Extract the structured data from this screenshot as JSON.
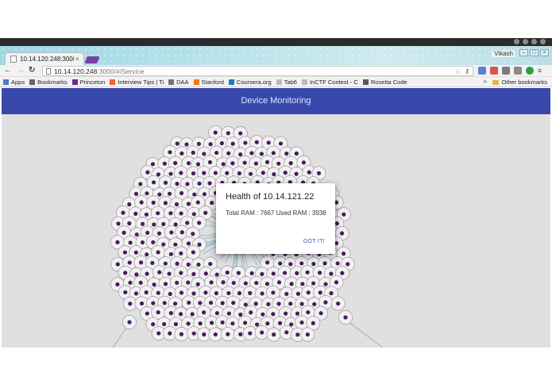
{
  "browser": {
    "tab": {
      "title": "10.14.120.248:3000/",
      "close_glyph": "×"
    },
    "profile_name": "Vikash",
    "address": {
      "host": "10.14.120.248",
      "path": ":3000/#/Service"
    },
    "bookmarks": [
      {
        "label": "Apps",
        "icon": "apps-grid-icon"
      },
      {
        "label": "Bookmarks",
        "icon": "star-icon"
      },
      {
        "label": "Princeton",
        "icon": "princeton-icon"
      },
      {
        "label": "Interview Tips | Ti",
        "icon": "yc-icon"
      },
      {
        "label": "DAA",
        "icon": "image-icon"
      },
      {
        "label": "Stanford",
        "icon": "blogger-icon"
      },
      {
        "label": "Coursera.org",
        "icon": "coursera-icon"
      },
      {
        "label": "Tab6",
        "icon": "page-icon"
      },
      {
        "label": "InCTF Contest - C",
        "icon": "page-icon"
      },
      {
        "label": "Rosetta Code",
        "icon": "rosetta-icon"
      }
    ],
    "bookmarks_overflow": "»",
    "other_bookmarks": "Other bookmarks"
  },
  "app": {
    "title": "Device Monitoring"
  },
  "dialog": {
    "title": "Health of 10.14.121.22",
    "body": "Total RAM : 7667 Used RAM : 3938",
    "ok_label": "GOT IT!"
  },
  "colors": {
    "header": "#3949ab",
    "node_fill": "#f1f1f1",
    "node_core": "#4a1a5e",
    "link": "#8fb3c7",
    "accent": "#3f51b5"
  }
}
